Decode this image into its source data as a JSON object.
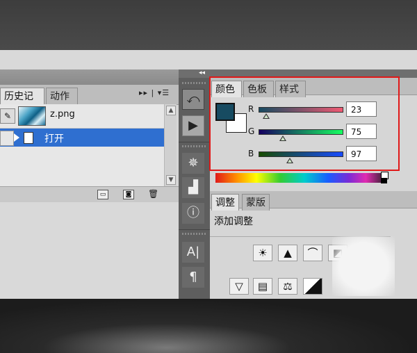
{
  "history_panel": {
    "tabs": [
      {
        "label": "历史记录"
      },
      {
        "label": "动作"
      }
    ],
    "menu_icon": "panel-menu-icon",
    "snapshot": {
      "name": "z.png"
    },
    "states": [
      {
        "label": "打开"
      }
    ]
  },
  "color_panel": {
    "tabs": [
      {
        "label": "颜色"
      },
      {
        "label": "色板"
      },
      {
        "label": "样式"
      }
    ],
    "foreground_color": "#174b61",
    "background_color": "#ffffff",
    "channels": [
      {
        "label": "R",
        "value": "23"
      },
      {
        "label": "G",
        "value": "75"
      },
      {
        "label": "B",
        "value": "97"
      }
    ]
  },
  "adjustments_panel": {
    "tabs": [
      {
        "label": "调整"
      },
      {
        "label": "蒙版"
      }
    ],
    "title": "添加调整",
    "icons": [
      "brightness-icon",
      "levels-icon",
      "curves-icon",
      "exposure-icon",
      "vibrance-icon",
      "hue-saturation-icon",
      "color-balance-icon",
      "black-white-icon"
    ]
  },
  "highlight_color": "#e01818"
}
